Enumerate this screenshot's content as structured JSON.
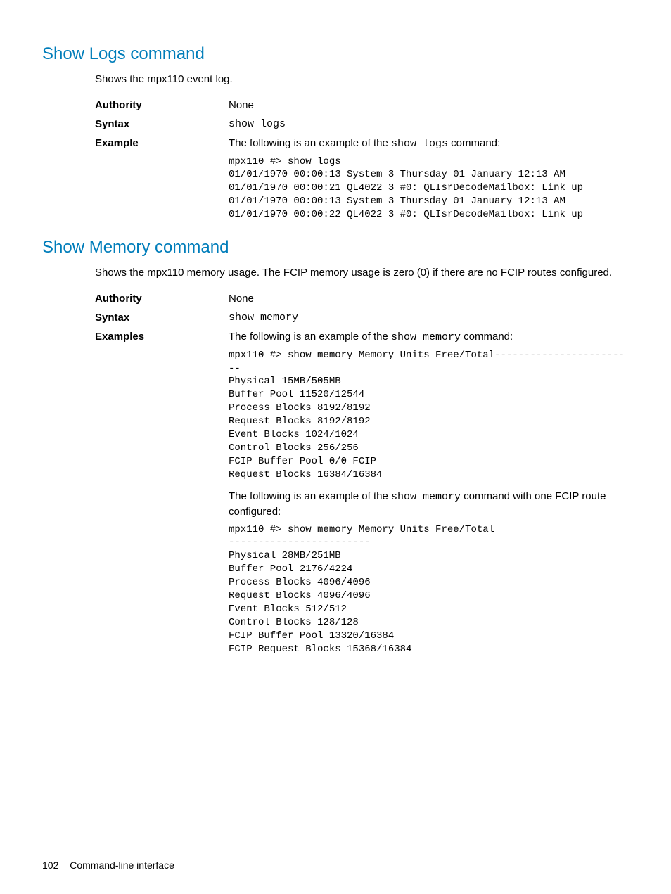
{
  "sections": [
    {
      "title": "Show Logs command",
      "desc": "Shows the mpx110 event log.",
      "rows": [
        {
          "label": "Authority",
          "value_plain": "None"
        },
        {
          "label": "Syntax",
          "value_mono": "show logs"
        },
        {
          "label": "Example",
          "intro_prefix": "The following is an example of the ",
          "intro_code": "show logs",
          "intro_suffix": " command:",
          "blocks": [
            "mpx110 #> show logs\n01/01/1970 00:00:13 System 3 Thursday 01 January 12:13 AM\n01/01/1970 00:00:21 QL4022 3 #0: QLIsrDecodeMailbox: Link up\n01/01/1970 00:00:13 System 3 Thursday 01 January 12:13 AM\n01/01/1970 00:00:22 QL4022 3 #0: QLIsrDecodeMailbox: Link up"
          ]
        }
      ]
    },
    {
      "title": "Show Memory command",
      "desc": "Shows the mpx110 memory usage. The FCIP memory usage is zero (0) if there are no FCIP routes configured.",
      "rows": [
        {
          "label": "Authority",
          "value_plain": "None"
        },
        {
          "label": "Syntax",
          "value_mono": "show memory"
        },
        {
          "label": "Examples",
          "intro_prefix": "The following is an example of the ",
          "intro_code": "show memory",
          "intro_suffix": " command:",
          "blocks": [
            "mpx110 #> show memory Memory Units Free/Total------------------------\nPhysical 15MB/505MB\nBuffer Pool 11520/12544\nProcess Blocks 8192/8192\nRequest Blocks 8192/8192\nEvent Blocks 1024/1024\nControl Blocks 256/256\nFCIP Buffer Pool 0/0 FCIP\nRequest Blocks 16384/16384"
          ],
          "intro2_prefix": "The following is an example of the ",
          "intro2_code": "show memory",
          "intro2_suffix": " command with one FCIP route configured:",
          "blocks2": [
            "mpx110 #> show memory Memory Units Free/Total\n------------------------\nPhysical 28MB/251MB\nBuffer Pool 2176/4224\nProcess Blocks 4096/4096\nRequest Blocks 4096/4096\nEvent Blocks 512/512\nControl Blocks 128/128\nFCIP Buffer Pool 13320/16384\nFCIP Request Blocks 15368/16384"
          ]
        }
      ]
    }
  ],
  "footer": {
    "page": "102",
    "title": "Command-line interface"
  }
}
